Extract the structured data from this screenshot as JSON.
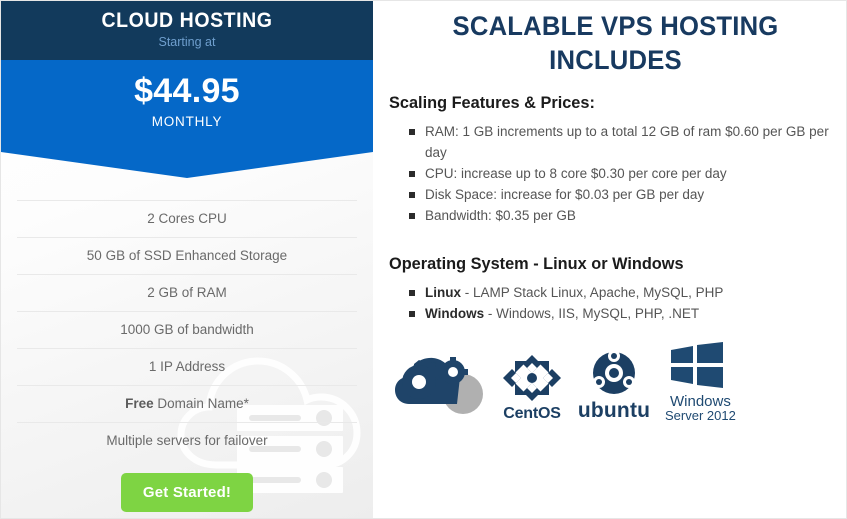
{
  "card": {
    "title": "CLOUD HOSTING",
    "subtitle": "Starting at",
    "price": "$44.95",
    "period": "MONTHLY",
    "features": [
      "2 Cores CPU",
      "50 GB of SSD Enhanced Storage",
      "2 GB of RAM",
      "1000 GB of bandwidth",
      "1 IP Address"
    ],
    "feature_free_bold": "Free",
    "feature_free_rest": " Domain Name*",
    "feature_failover": "Multiple servers for failover",
    "cta_label": "Get Started!",
    "colors": {
      "header_navy": "#123a5c",
      "price_blue": "#0568c8",
      "cta_green": "#7ed443",
      "subtitle_blue": "#6f9fce"
    }
  },
  "content": {
    "main_title": "SCALABLE VPS HOSTING INCLUDES",
    "scaling_title": "Scaling Features & Prices:",
    "scaling_items": [
      "RAM: 1 GB increments up to a total 12 GB of ram $0.60 per GB per day",
      "CPU: increase up to 8 core $0.30 per core per day",
      "Disk Space: increase for $0.03 per GB per day",
      "Bandwidth: $0.35 per GB"
    ],
    "os_title": "Operating System - Linux or Windows",
    "os_items": [
      {
        "name": "Linux",
        "detail": " - LAMP Stack Linux, Apache, MySQL, PHP"
      },
      {
        "name": "Windows",
        "detail": " - Windows, IIS, MySQL, PHP, .NET"
      }
    ],
    "logos": [
      {
        "id": "cloudlinux-gears-icon",
        "caption": ""
      },
      {
        "id": "centos-icon",
        "caption": "CentOS"
      },
      {
        "id": "ubuntu-icon",
        "caption": "ubuntu"
      },
      {
        "id": "windows-icon",
        "caption_line1": "Windows",
        "caption_line2": "Server 2012"
      }
    ],
    "colors": {
      "title_navy": "#183a60",
      "logo_navy": "#1c3f63",
      "logo_grey": "#b0b0b0"
    }
  }
}
